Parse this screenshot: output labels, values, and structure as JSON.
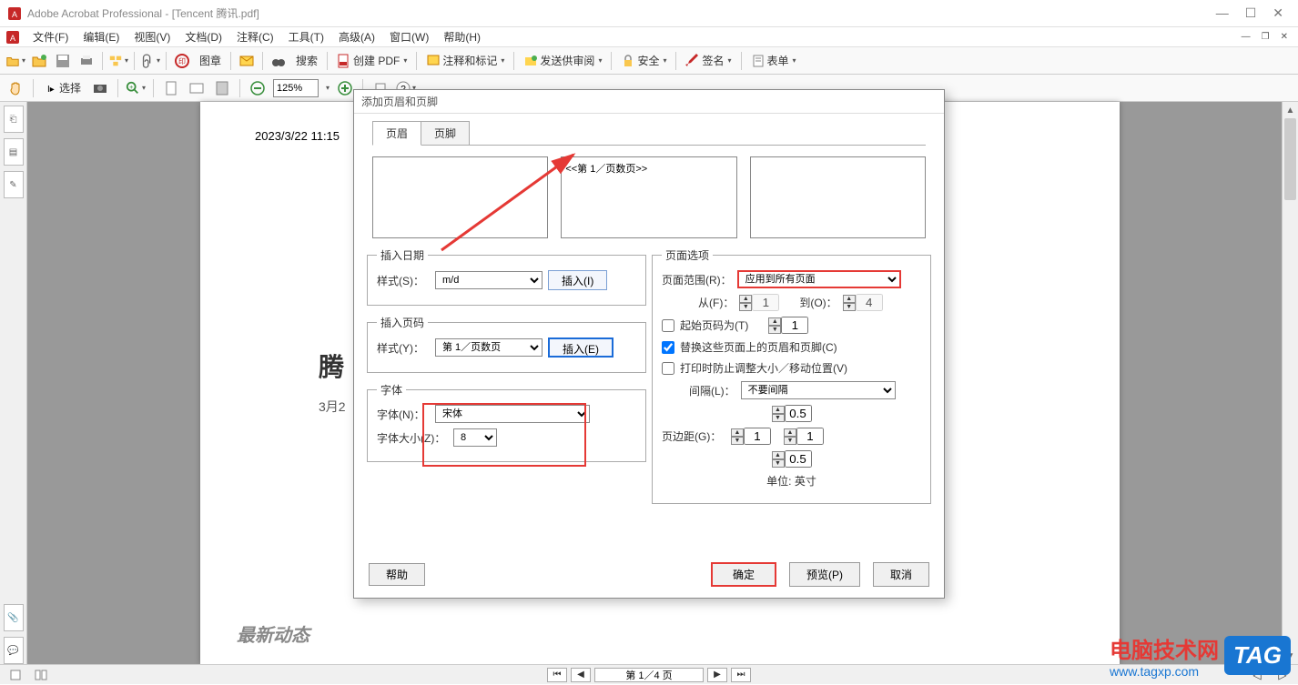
{
  "app": {
    "title": "Adobe Acrobat Professional - [Tencent 腾讯.pdf]"
  },
  "menu": {
    "file": "文件(F)",
    "edit": "编辑(E)",
    "view": "视图(V)",
    "doc": "文档(D)",
    "comment": "注释(C)",
    "tools": "工具(T)",
    "adv": "高级(A)",
    "window": "窗口(W)",
    "help": "帮助(H)"
  },
  "toolbar": {
    "create_pdf": "创建 PDF",
    "annotate": "注释和标记",
    "send_review": "发送供审阅",
    "security": "安全",
    "sign": "签名",
    "forms": "表单",
    "select": "选择",
    "search": "搜索",
    "stamp": "图章"
  },
  "zoom": {
    "value": "125%"
  },
  "page": {
    "datetime": "2023/3/22 11:15",
    "title_partial": "腾",
    "date_partial": "3月2",
    "section": "最新动态",
    "nav": "第 1／4 页"
  },
  "dialog": {
    "title": "添加页眉和页脚",
    "tab_header": "页眉",
    "tab_footer": "页脚",
    "box_center": "<<第 1／页数页>>",
    "insert_date_legend": "插入日期",
    "style_s": "样式(S)：",
    "style_s_value": "m/d",
    "insert_i": "插入(I)",
    "insert_page_legend": "插入页码",
    "style_y": "样式(Y)：",
    "style_y_value": "第 1／页数页",
    "insert_e": "插入(E)",
    "font_legend": "字体",
    "font_n": "字体(N)：",
    "font_value": "宋体",
    "font_size": "字体大小(Z)：",
    "font_size_value": "8",
    "page_options_legend": "页面选项",
    "page_range": "页面范围(R)：",
    "page_range_value": "应用到所有页面",
    "from": "从(F)：",
    "from_value": "1",
    "to": "到(O)：",
    "to_value": "4",
    "start_page": "起始页码为(T)",
    "start_page_value": "1",
    "replace": "替换这些页面上的页眉和页脚(C)",
    "prevent": "打印时防止调整大小／移动位置(V)",
    "spacing": "间隔(L)：",
    "spacing_value": "不要间隔",
    "margin_top": "0.5",
    "margin_side1": "1",
    "margin_side2": "1",
    "margin_bottom": "0.5",
    "page_margin": "页边距(G)：",
    "unit": "单位: 英寸",
    "help": "帮助",
    "ok": "确定",
    "preview": "预览(P)",
    "cancel": "取消"
  },
  "watermark": {
    "line1": "电脑技术网",
    "line2": "www.tagxp.com",
    "tag": "TAG"
  },
  "icons": {
    "pdf": "pdf-icon",
    "folder": "folder-icon",
    "save": "save-icon",
    "print": "print-icon",
    "attach": "attach-icon",
    "stamp": "stamp-icon",
    "mail": "mail-icon",
    "binoc": "binoculars-icon",
    "hand": "hand-icon",
    "select": "select-icon",
    "camera": "camera-icon",
    "zoom": "zoom-icon",
    "page1": "page-mode-icon",
    "lock": "lock-icon",
    "pen": "pen-icon",
    "form": "form-icon"
  }
}
